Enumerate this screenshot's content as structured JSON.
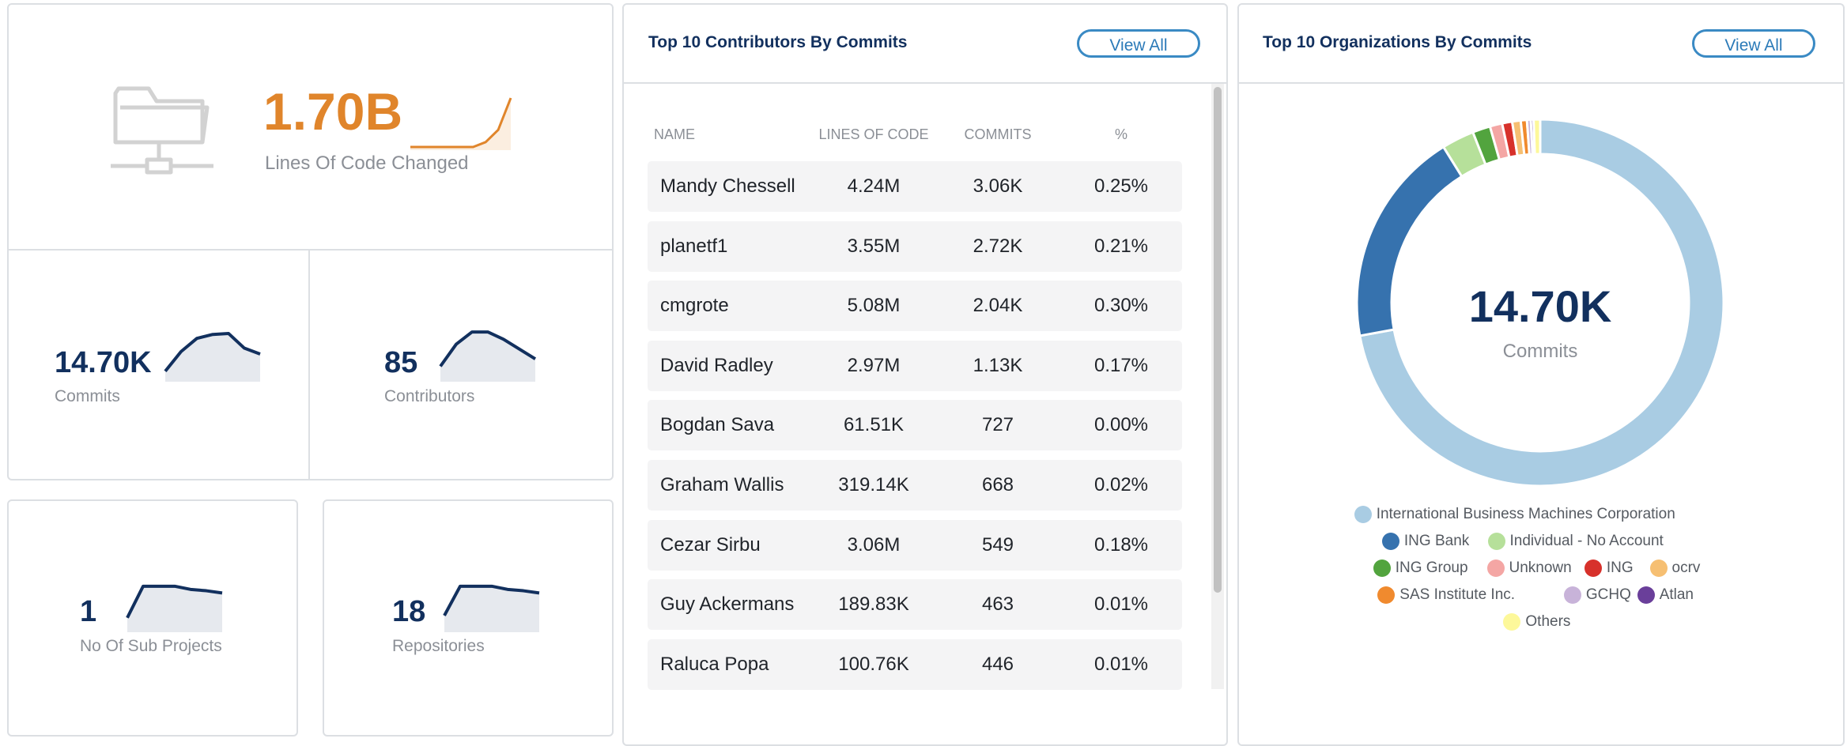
{
  "summary": {
    "loc": {
      "value": "1.70B",
      "label": "Lines Of Code Changed",
      "spark": [
        0,
        0,
        0,
        0,
        0,
        0,
        0.1,
        0.35,
        1.0
      ]
    },
    "commits": {
      "value": "14.70K",
      "label": "Commits",
      "spark": [
        0.15,
        0.55,
        0.82,
        0.9,
        0.92,
        0.62,
        0.5
      ]
    },
    "contributors": {
      "value": "85",
      "label": "Contributors",
      "spark": [
        0.25,
        0.7,
        0.95,
        0.95,
        0.8,
        0.6,
        0.4
      ]
    },
    "subprojects": {
      "value": "1",
      "label": "No Of Sub Projects",
      "spark": [
        0.25,
        0.95,
        0.95,
        0.95,
        0.88,
        0.85,
        0.8
      ]
    },
    "repos": {
      "value": "18",
      "label": "Repositories",
      "spark": [
        0.3,
        0.95,
        0.95,
        0.95,
        0.88,
        0.85,
        0.8
      ]
    }
  },
  "contributors_panel": {
    "title": "Top 10 Contributors By Commits",
    "view_all": "View All",
    "headers": [
      "NAME",
      "LINES OF CODE",
      "COMMITS",
      "%"
    ],
    "rows": [
      [
        "Mandy Chessell",
        "4.24M",
        "3.06K",
        "0.25%"
      ],
      [
        "planetf1",
        "3.55M",
        "2.72K",
        "0.21%"
      ],
      [
        "cmgrote",
        "5.08M",
        "2.04K",
        "0.30%"
      ],
      [
        "David Radley",
        "2.97M",
        "1.13K",
        "0.17%"
      ],
      [
        "Bogdan Sava",
        "61.51K",
        "727",
        "0.00%"
      ],
      [
        "Graham Wallis",
        "319.14K",
        "668",
        "0.02%"
      ],
      [
        "Cezar Sirbu",
        "3.06M",
        "549",
        "0.18%"
      ],
      [
        "Guy Ackermans",
        "189.83K",
        "463",
        "0.01%"
      ],
      [
        "Raluca Popa",
        "100.76K",
        "446",
        "0.01%"
      ]
    ]
  },
  "orgs_panel": {
    "title": "Top 10 Organizations By Commits",
    "view_all": "View All",
    "center_value": "14.70K",
    "center_label": "Commits"
  },
  "chart_data": {
    "type": "pie",
    "variant": "donut",
    "title": "Top 10 Organizations By Commits",
    "legend_position": "bottom",
    "series": [
      {
        "name": "International Business Machines Corporation",
        "value": 10600,
        "color": "#a9cce3"
      },
      {
        "name": "ING Bank",
        "value": 2800,
        "color": "#3672ae"
      },
      {
        "name": "Individual - No Account",
        "value": 420,
        "color": "#b6e09a"
      },
      {
        "name": "ING Group",
        "value": 230,
        "color": "#52a43e"
      },
      {
        "name": "Unknown",
        "value": 160,
        "color": "#f4a6a4"
      },
      {
        "name": "ING",
        "value": 130,
        "color": "#d7312b"
      },
      {
        "name": "ocrv",
        "value": 110,
        "color": "#f6bf72"
      },
      {
        "name": "SAS Institute Inc.",
        "value": 80,
        "color": "#f08a2e"
      },
      {
        "name": "GCHQ",
        "value": 50,
        "color": "#c8b3d9"
      },
      {
        "name": "Atlan",
        "value": 35,
        "color": "#6a3f9a"
      },
      {
        "name": "Others",
        "value": 85,
        "color": "#fdf89a"
      }
    ]
  },
  "colors": {
    "accent_orange": "#e0852b",
    "navy": "#12305e",
    "button_blue": "#3a8ac4"
  }
}
